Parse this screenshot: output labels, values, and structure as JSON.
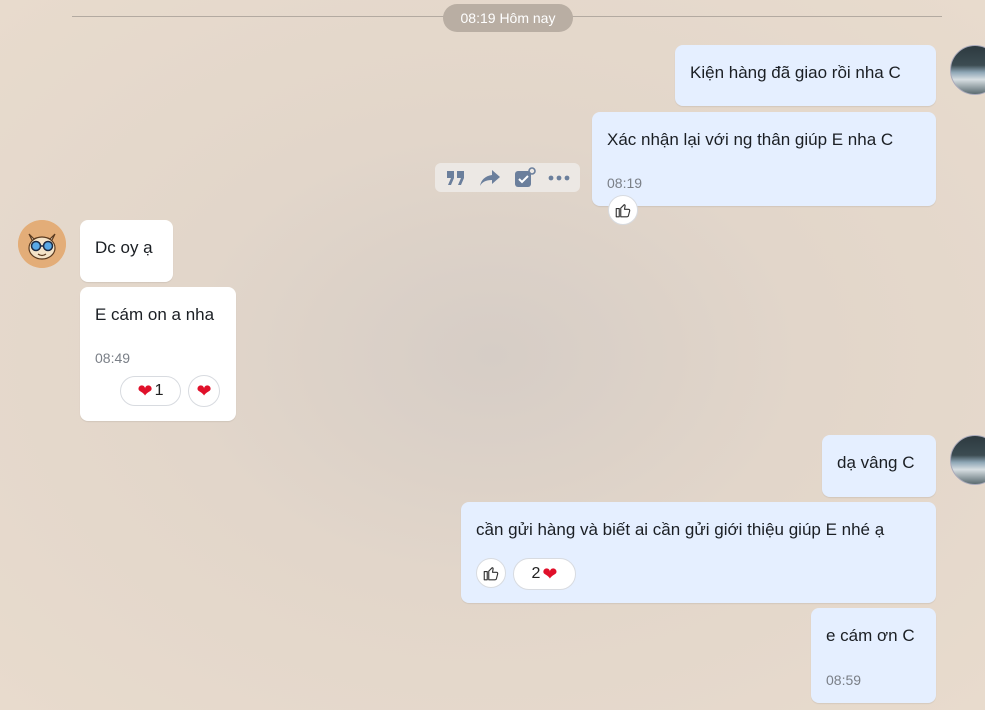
{
  "divider": {
    "label": "08:19 Hôm nay"
  },
  "messages": [
    {
      "text": "Kiện hàng đã giao rồi nha C"
    },
    {
      "text": "Xác nhận lại với ng thân giúp E nha C",
      "time": "08:19"
    },
    {
      "text": "Dc oy ạ"
    },
    {
      "text": "E cám on a nha",
      "time": "08:49"
    },
    {
      "text": "dạ vâng C"
    },
    {
      "text": "cần gửi hàng và biết ai cần gửi giới thiệu giúp E nhé ạ"
    },
    {
      "text": "e cám ơn C",
      "time": "08:59"
    }
  ],
  "reactions": {
    "msg4_heart_count": "1",
    "msg6_heart_count": "2"
  },
  "toolbar": {
    "actions": [
      "quote-icon",
      "forward-icon",
      "mark-task-icon",
      "more-icon"
    ]
  },
  "colors": {
    "sent_bubble": "#e5efff",
    "received_bubble": "#ffffff",
    "heart": "#e0102a",
    "icon_gray": "#6b7f9c"
  }
}
